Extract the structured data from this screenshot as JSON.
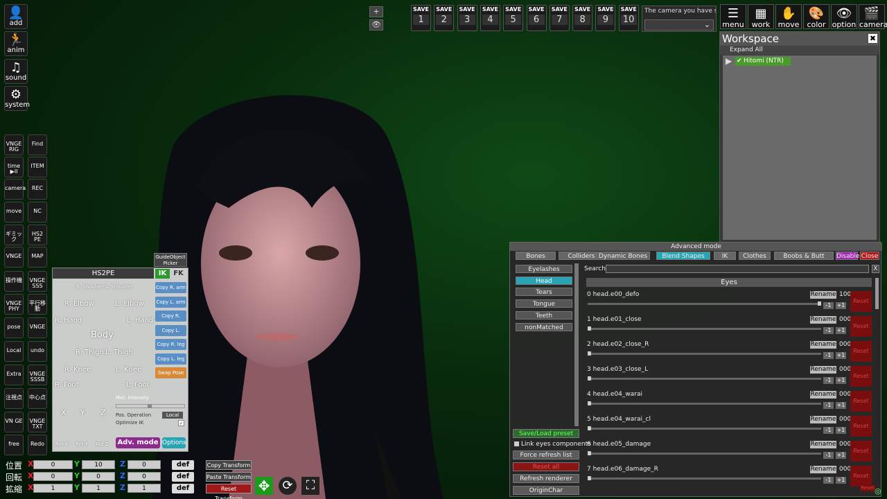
{
  "toolbar_left": [
    {
      "name": "add",
      "label": "add",
      "icon": "👤"
    },
    {
      "name": "anim",
      "label": "anim",
      "icon": "🏃"
    },
    {
      "name": "sound",
      "label": "sound",
      "icon": "♫"
    },
    {
      "name": "system",
      "label": "system",
      "icon": "⚙"
    }
  ],
  "tools_grid": [
    [
      "VNGE RIG",
      "Find"
    ],
    [
      "time ▶II",
      "ITEM"
    ],
    [
      "camera",
      "REC"
    ],
    [
      "move",
      "NC"
    ],
    [
      "ギミック",
      "HS2 PE"
    ],
    [
      "VNGE",
      "MAP"
    ],
    [
      "操作機",
      "VNGE SSS"
    ],
    [
      "VNGE PHY",
      "平行移動"
    ],
    [
      "pose",
      "VNGE"
    ],
    [
      "Local",
      "undo"
    ],
    [
      "Extra",
      "VNGE SSSB"
    ],
    [
      "注視点",
      "中心点"
    ],
    [
      "VN GE",
      "VNGE TXT"
    ],
    [
      "free",
      "Redo"
    ]
  ],
  "save_bar": {
    "buttons": [
      {
        "label": "SAVE",
        "num": "1"
      },
      {
        "label": "SAVE",
        "num": "2"
      },
      {
        "label": "SAVE",
        "num": "3"
      },
      {
        "label": "SAVE",
        "num": "4"
      },
      {
        "label": "SAVE",
        "num": "5"
      },
      {
        "label": "SAVE",
        "num": "6"
      },
      {
        "label": "SAVE",
        "num": "7"
      },
      {
        "label": "SAVE",
        "num": "8"
      },
      {
        "label": "SAVE",
        "num": "9"
      },
      {
        "label": "SAVE",
        "num": "10"
      }
    ],
    "plus": "+",
    "eye": "👁"
  },
  "camera_select": {
    "text": "The camera you have set"
  },
  "top_right": [
    {
      "label": "menu",
      "icon": "☰"
    },
    {
      "label": "work",
      "icon": "▦"
    },
    {
      "label": "move",
      "icon": "✋"
    },
    {
      "label": "color",
      "icon": "🎨"
    },
    {
      "label": "option",
      "icon": "👁"
    },
    {
      "label": "camera",
      "icon": "🎬"
    }
  ],
  "workspace": {
    "title": "Workspace",
    "close": "✖",
    "expand_all": "Expand All",
    "node": "Hitomi (NTR)"
  },
  "hs2pe": {
    "title": "HS2PE",
    "ik": "IK",
    "fk": "FK",
    "guide": "GuideObject Picker",
    "body_labels": {
      "r_shoulder": "R. Shoulder",
      "l_shoulder": "L. Shoulder",
      "r_elbow": "R. Elbow",
      "l_elbow": "L. Elbow",
      "r_hand": "R. Hand",
      "l_hand": "L. Hand",
      "body": "Body",
      "r_thigh": "R. Thigh",
      "l_thigh": "L. Thigh",
      "r_knee": "R. Knee",
      "l_knee": "L. Knee",
      "r_foot": "R. Foot",
      "l_foot": "L. Foot",
      "x": "X",
      "y": "Y",
      "z": "Z",
      "rot_x": "Rot X",
      "rot_y": "Rot Y",
      "rot_z": "Rot Z"
    },
    "copy_buttons": [
      "Copy R. arm",
      "Copy L. arm",
      "Copy R. hand",
      "Copy L. hand",
      "Copy R. leg",
      "Copy L. leg"
    ],
    "swap": "Swap Pose",
    "mvt": "Mvt. Intensity",
    "pos_op": "Pos. Operation",
    "local": "Local",
    "opt_ik": "Optimize IK",
    "adv_mode": "Adv. mode",
    "options": "Options"
  },
  "transform": {
    "rows": [
      {
        "label": "位置",
        "x": "0",
        "y": "10",
        "z": "0"
      },
      {
        "label": "回転",
        "x": "0",
        "y": "0",
        "z": "0"
      },
      {
        "label": "拡縮",
        "x": "1",
        "y": "1",
        "z": "1"
      }
    ],
    "axis_x": "X",
    "axis_y": "Y",
    "axis_z": "Z",
    "def": "def",
    "copy": "Copy Transform",
    "paste": "Paste Transform",
    "reset": "Reset Transform"
  },
  "advanced": {
    "title": "Advanced mode",
    "tabs": [
      "Bones",
      "Colliders",
      "Dynamic Bones",
      "Blend Shapes",
      "IK",
      "Clothes",
      "Boobs & Butt",
      "Disable",
      "Close"
    ],
    "categories": [
      "Eyelashes",
      "Head",
      "Tears",
      "Tongue",
      "Teeth",
      "nonMatched"
    ],
    "search": "Search",
    "search_clear": "X",
    "group": "Eyes",
    "rename": "Rename",
    "reset": "Reset",
    "minus": "-1",
    "plus": "+1",
    "rows": [
      {
        "name": "0 head.e00_defo",
        "value": "100",
        "frac": 1.0
      },
      {
        "name": "1 head.e01_close",
        "value": "000",
        "frac": 0
      },
      {
        "name": "2 head.e02_close_R",
        "value": "000",
        "frac": 0
      },
      {
        "name": "3 head.e03_close_L",
        "value": "000",
        "frac": 0
      },
      {
        "name": "4 head.e04_warai",
        "value": "000",
        "frac": 0
      },
      {
        "name": "5 head.e04_warai_cl",
        "value": "000",
        "frac": 0
      },
      {
        "name": "6 head.e05_damage",
        "value": "000",
        "frac": 0
      },
      {
        "name": "7 head.e06_damage_R",
        "value": "000",
        "frac": 0
      }
    ],
    "save_load": "Save/Load preset",
    "link_eyes": "Link eyes components",
    "force_refresh": "Force refresh list",
    "reset_all": "Reset all",
    "refresh_renderer": "Refresh renderer",
    "origin_char": "OriginChar",
    "reset_small": "Reset"
  },
  "colors": {
    "accent": "#2aa4b5",
    "reset": "#7a0d0d",
    "green": "#4a9a2e",
    "adv": "#8e2a8f"
  }
}
